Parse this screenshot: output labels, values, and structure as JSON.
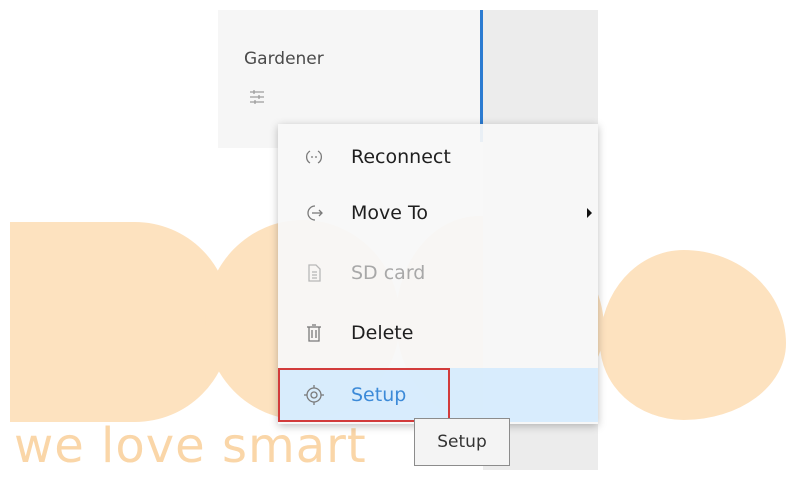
{
  "device": {
    "name": "Gardener"
  },
  "context_menu": {
    "items": [
      {
        "label": "Reconnect",
        "icon": "reconnect-icon",
        "disabled": false
      },
      {
        "label": "Move To",
        "icon": "move-to-icon",
        "disabled": false,
        "has_submenu": true
      },
      {
        "label": "SD card",
        "icon": "sd-card-icon",
        "disabled": true
      },
      {
        "label": "Delete",
        "icon": "trash-icon",
        "disabled": false
      },
      {
        "label": "Setup",
        "icon": "gear-icon",
        "disabled": false,
        "hovered": true
      }
    ]
  },
  "tooltip": {
    "text": "Setup"
  },
  "watermark": {
    "tagline": "we love smart"
  },
  "colors": {
    "watermark": "#fde2bf",
    "selection_bar": "#2b7bd1",
    "highlight_outline": "#d23b3b"
  }
}
